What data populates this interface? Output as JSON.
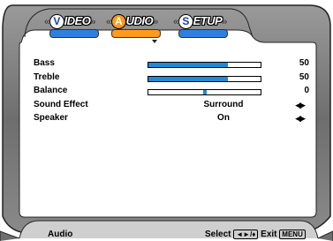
{
  "tabs": [
    {
      "first": "V",
      "rest": "IDEO",
      "bar_color": "#2f7fe0",
      "active": false
    },
    {
      "first": "A",
      "rest": "UDIO",
      "bar_color": "#ff9a1a",
      "active": true
    },
    {
      "first": "S",
      "rest": "ETUP",
      "bar_color": "#2f7fe0",
      "active": false
    }
  ],
  "settings": {
    "bass": {
      "label": "Bass",
      "value": "50",
      "level": 0.71
    },
    "treble": {
      "label": "Treble",
      "value": "50",
      "level": 0.71
    },
    "balance": {
      "label": "Balance",
      "value": "0",
      "position": 0.5
    },
    "sound_effect": {
      "label": "Sound Effect",
      "value": "Surround"
    },
    "speaker": {
      "label": "Speaker",
      "value": "On"
    }
  },
  "footer": {
    "section": "Audio",
    "select_label": "Select",
    "select_key": "◄►/♦",
    "exit_label": "Exit",
    "exit_key": "MENU"
  },
  "colors": {
    "accent_blue": "#1f8bd6",
    "accent_orange": "#ff9a1a",
    "frame_gray": "#7a7a7a"
  }
}
